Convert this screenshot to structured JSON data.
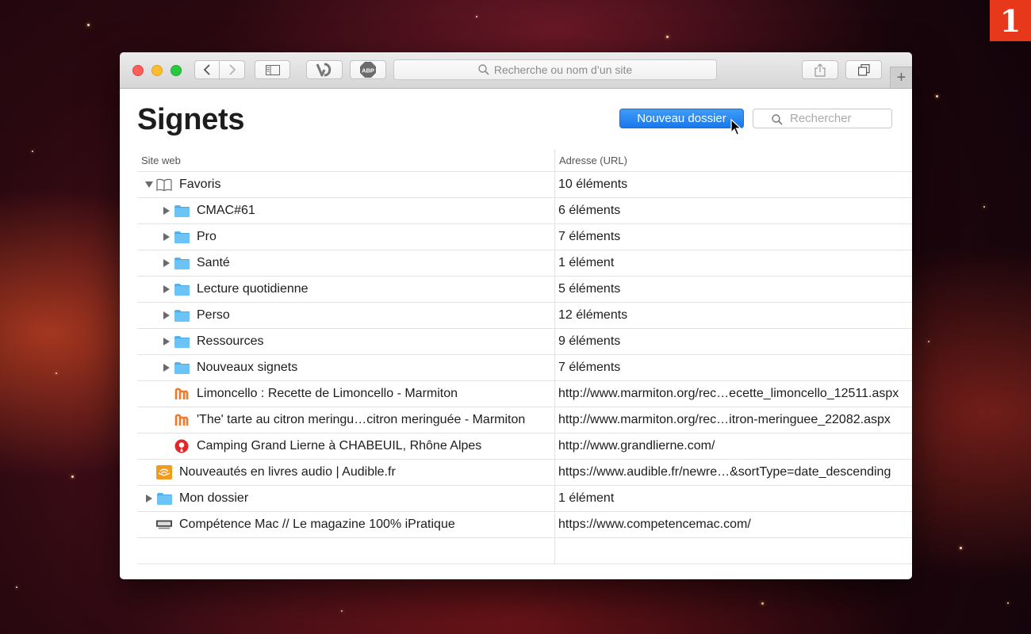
{
  "badge": "1",
  "toolbar": {
    "address_placeholder": "Recherche ou nom d’un site",
    "extension_abp": "ABP",
    "icons": [
      "back-icon",
      "forward-icon",
      "sidebar-icon",
      "vivaldi-extension-icon",
      "adblock-icon",
      "share-icon",
      "tabs-overview-icon",
      "new-tab-icon"
    ]
  },
  "page": {
    "title": "Signets",
    "new_folder_label": "Nouveau dossier",
    "search_placeholder": "Rechercher"
  },
  "table": {
    "headers": {
      "site": "Site web",
      "url": "Adresse (URL)"
    },
    "rows": [
      {
        "level": 0,
        "disclosure": "expanded",
        "icon": "book-icon",
        "name": "Favoris",
        "url": "10 éléments"
      },
      {
        "level": 1,
        "disclosure": "collapsed",
        "icon": "folder-icon",
        "name": "CMAC#61",
        "url": "6 éléments"
      },
      {
        "level": 1,
        "disclosure": "collapsed",
        "icon": "folder-icon",
        "name": "Pro",
        "url": "7 éléments"
      },
      {
        "level": 1,
        "disclosure": "collapsed",
        "icon": "folder-icon",
        "name": "Santé",
        "url": "1 élément"
      },
      {
        "level": 1,
        "disclosure": "collapsed",
        "icon": "folder-icon",
        "name": "Lecture quotidienne",
        "url": "5 éléments"
      },
      {
        "level": 1,
        "disclosure": "collapsed",
        "icon": "folder-icon",
        "name": "Perso",
        "url": "12 éléments"
      },
      {
        "level": 1,
        "disclosure": "collapsed",
        "icon": "folder-icon",
        "name": "Ressources",
        "url": "9 éléments"
      },
      {
        "level": 1,
        "disclosure": "collapsed",
        "icon": "folder-icon",
        "name": "Nouveaux signets",
        "url": "7 éléments"
      },
      {
        "level": 1,
        "disclosure": "none",
        "icon": "marmiton-favicon",
        "name": "Limoncello : Recette de Limoncello - Marmiton",
        "url": "http://www.marmiton.org/rec…ecette_limoncello_12511.aspx"
      },
      {
        "level": 1,
        "disclosure": "none",
        "icon": "marmiton-favicon",
        "name": "'The' tarte au citron meringu…citron meringuée - Marmiton",
        "url": "http://www.marmiton.org/rec…itron-meringuee_22082.aspx"
      },
      {
        "level": 1,
        "disclosure": "none",
        "icon": "camping-favicon",
        "name": "Camping Grand Lierne à CHABEUIL, Rhône Alpes",
        "url": "http://www.grandlierne.com/"
      },
      {
        "level": 0,
        "disclosure": "none",
        "icon": "audible-favicon",
        "name": "Nouveautés en livres audio | Audible.fr",
        "url": "https://www.audible.fr/newre…&sortType=date_descending"
      },
      {
        "level": 0,
        "disclosure": "collapsed",
        "icon": "folder-icon",
        "name": "Mon dossier",
        "url": "1 élément"
      },
      {
        "level": 0,
        "disclosure": "none",
        "icon": "competencemac-favicon",
        "name": "Compétence Mac // Le magazine 100% iPratique",
        "url": "https://www.competencemac.com/"
      },
      {
        "level": 0,
        "disclosure": "none",
        "icon": "",
        "name": "",
        "url": ""
      }
    ]
  }
}
